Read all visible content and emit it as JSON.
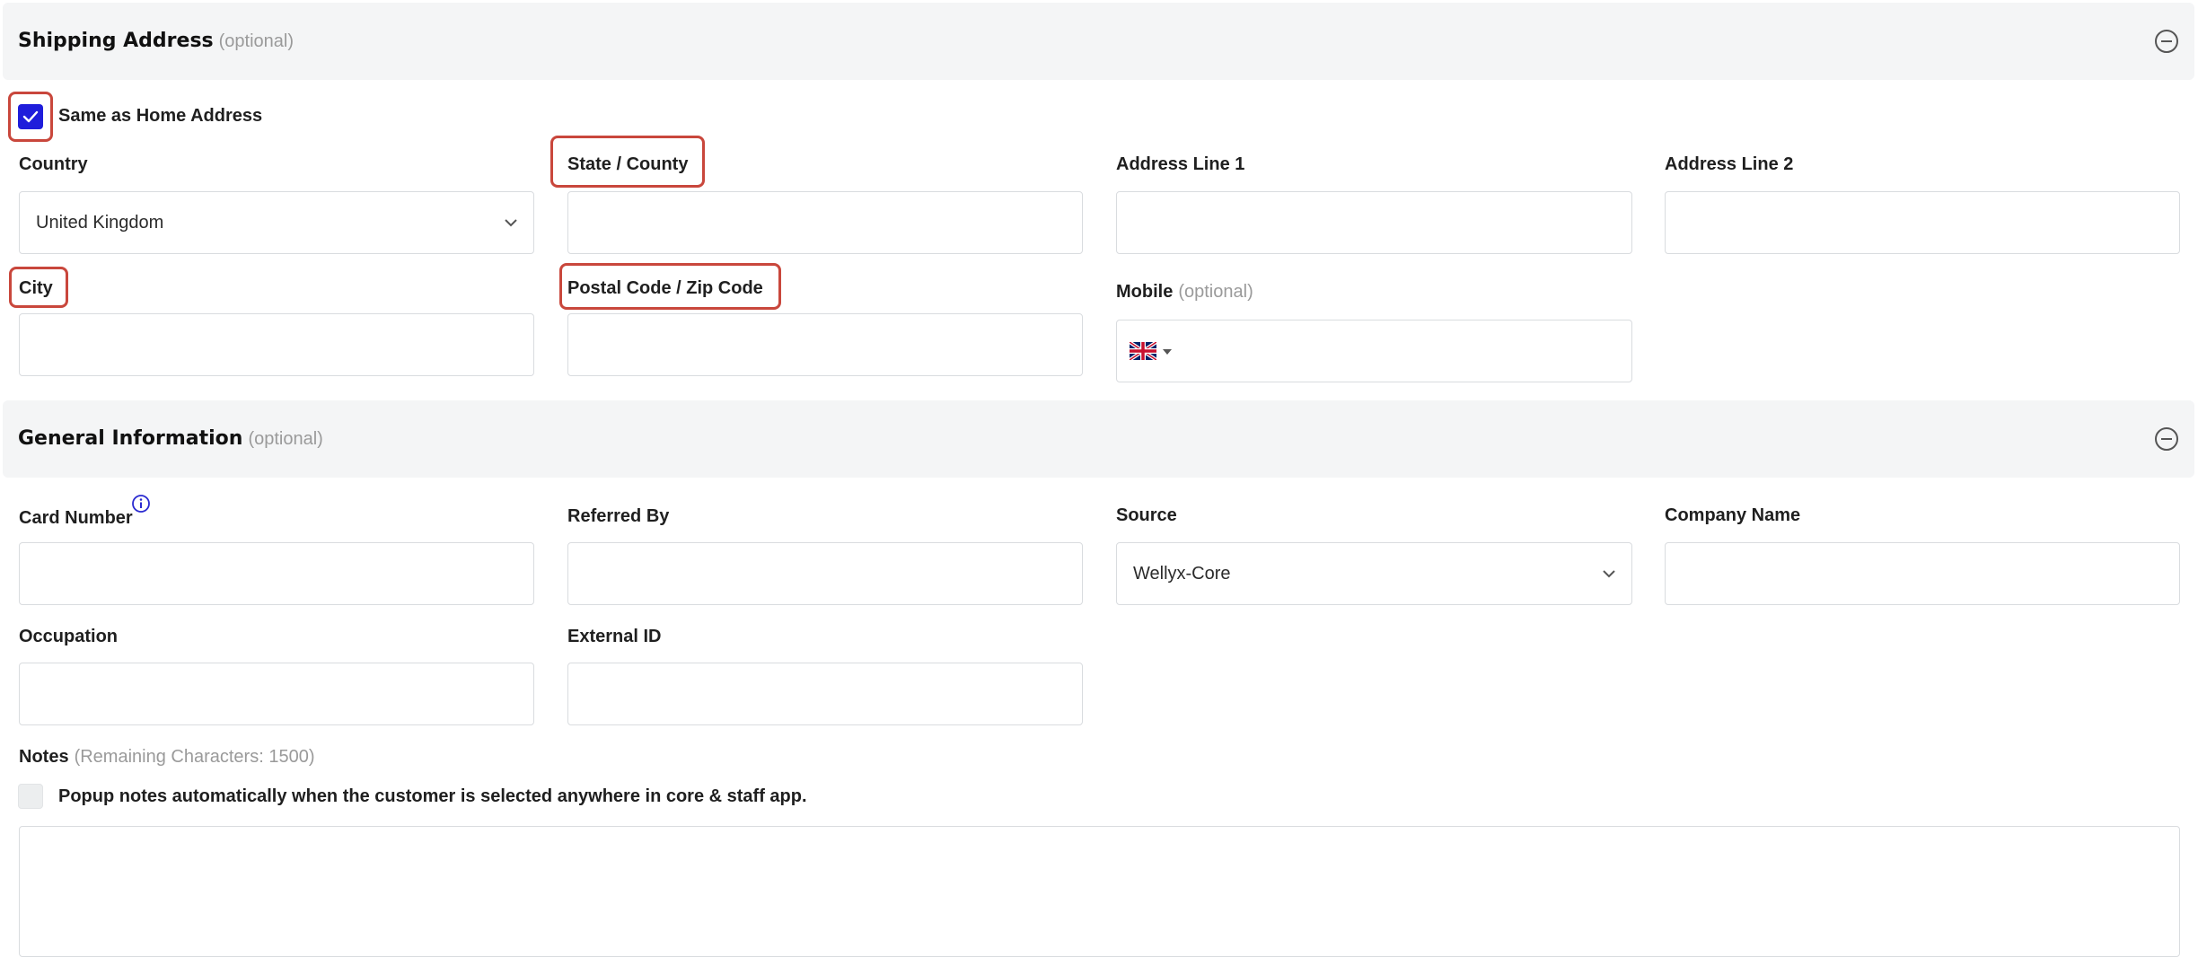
{
  "shipping": {
    "title": "Shipping Address",
    "optional": "(optional)",
    "same_as_home_label": "Same as Home Address",
    "same_as_home_checked": true,
    "country_label": "Country",
    "country_value": "United Kingdom",
    "state_label": "State / County",
    "state_value": "",
    "address1_label": "Address Line 1",
    "address1_value": "",
    "address2_label": "Address Line 2",
    "address2_value": "",
    "city_label": "City",
    "city_value": "",
    "postal_label": "Postal Code / Zip Code",
    "postal_value": "",
    "mobile_label": "Mobile",
    "mobile_optional": "(optional)",
    "mobile_value": "",
    "mobile_flag": "uk-flag-icon"
  },
  "general": {
    "title": "General Information",
    "optional": "(optional)",
    "card_number_label": "Card Number",
    "card_number_value": "",
    "referred_by_label": "Referred By",
    "referred_by_value": "",
    "source_label": "Source",
    "source_value": "Wellyx-Core",
    "company_label": "Company Name",
    "company_value": "",
    "occupation_label": "Occupation",
    "occupation_value": "",
    "external_id_label": "External ID",
    "external_id_value": "",
    "notes_label": "Notes",
    "notes_remaining": "(Remaining Characters: 1500)",
    "popup_notes_label": "Popup notes automatically when the customer is selected anywhere in core & staff app.",
    "popup_notes_checked": false,
    "notes_value": ""
  },
  "colors": {
    "accent": "#1f1ddb",
    "highlight": "#c9473c",
    "header_bg": "#f4f5f6",
    "border": "#d9dcdf"
  },
  "icons": {
    "collapse": "minus-circle-icon",
    "dropdown": "chevron-down-icon",
    "info": "info-icon",
    "check": "check-icon"
  }
}
